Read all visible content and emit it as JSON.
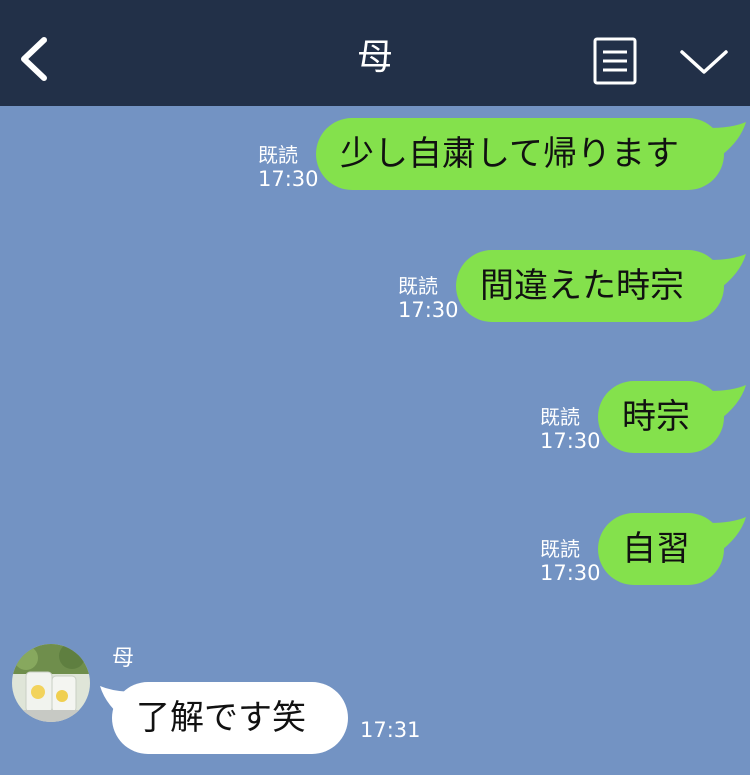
{
  "header": {
    "title": "母",
    "icons": [
      "back-chevron-icon",
      "menu-list-icon",
      "chevron-down-icon"
    ]
  },
  "messages": [
    {
      "direction": "out",
      "text": "少し自粛して帰ります",
      "read": "既読",
      "time": "17:30"
    },
    {
      "direction": "out",
      "text": "間違えた時宗",
      "read": "既読",
      "time": "17:30"
    },
    {
      "direction": "out",
      "text": "時宗",
      "read": "既読",
      "time": "17:30"
    },
    {
      "direction": "out",
      "text": "自習",
      "read": "既読",
      "time": "17:30"
    },
    {
      "direction": "in",
      "sender": "母",
      "text": "了解です笑",
      "time": "17:31"
    }
  ],
  "colors": {
    "header_bg": "#223048",
    "chat_bg": "#7393c3",
    "outgoing_bubble": "#84e14c",
    "incoming_bubble": "#ffffff"
  }
}
